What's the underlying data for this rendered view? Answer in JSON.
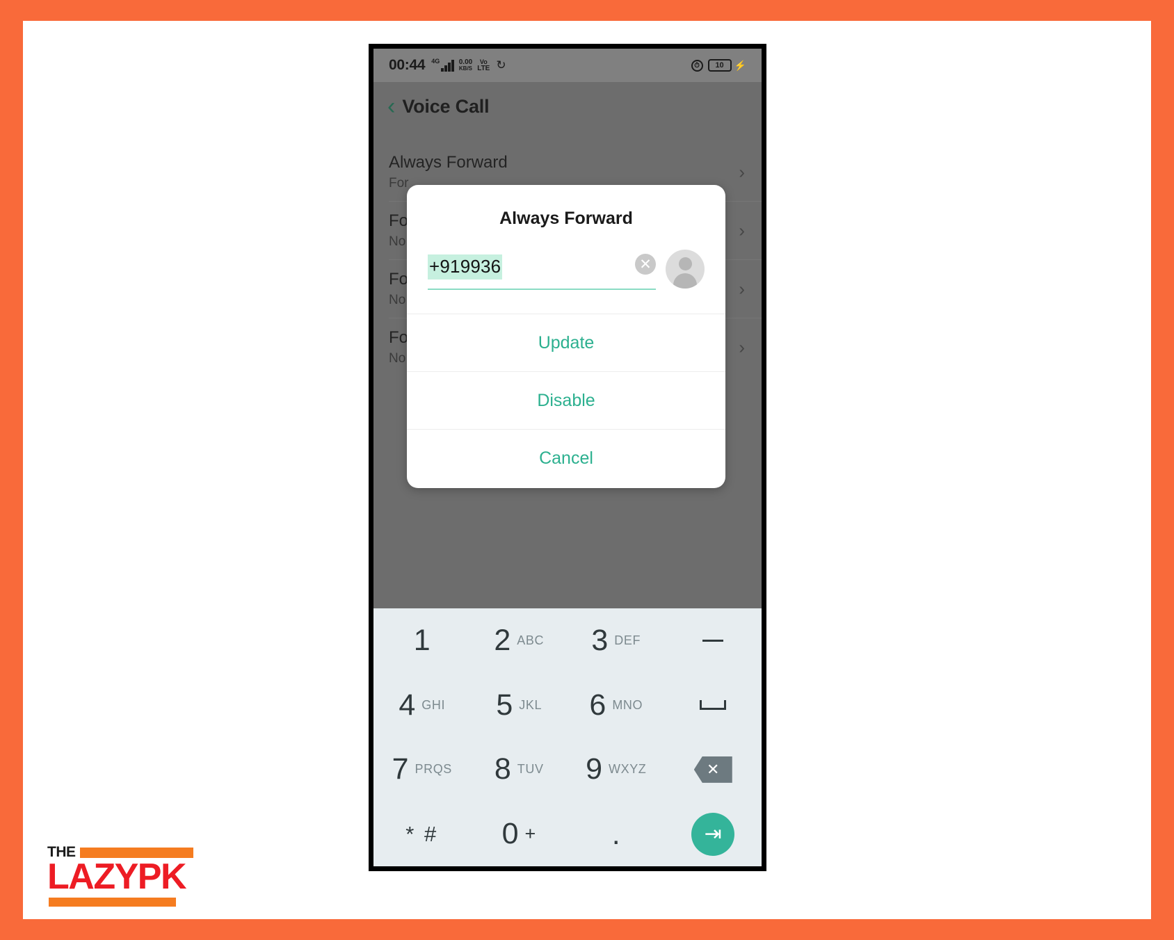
{
  "watermark": {
    "the": "THE",
    "name": "LAZYPK"
  },
  "colors": {
    "page_border": "#F96A3A",
    "accent_teal": "#2CB08F",
    "enter_key": "#34B49A",
    "arrow_red": "#C0191F",
    "selection_green": "#C6F0DF",
    "keypad_bg": "#E7EDF0",
    "logo_orange": "#F57C20",
    "logo_red": "#ED1C24"
  },
  "status_bar": {
    "time": "00:44",
    "network_gen": "4G",
    "data_rate_value": "0.00",
    "data_rate_unit": "KB/S",
    "volte_top": "Vo",
    "volte_bottom": "LTE",
    "sync_icon": "sync-icon",
    "alarm_icon": "alarm-icon",
    "battery_level": "10",
    "charging_icon": "charging-bolt-icon"
  },
  "app_bar": {
    "back_icon": "back-chevron-icon",
    "title": "Voice Call"
  },
  "settings_list": [
    {
      "title": "Always Forward",
      "subtitle": "For",
      "chevron": "chevron-right-icon"
    },
    {
      "title": "Fo",
      "subtitle": "No",
      "chevron": "chevron-right-icon"
    },
    {
      "title": "Fo",
      "subtitle": "No",
      "chevron": "chevron-right-icon"
    },
    {
      "title": "Fo",
      "subtitle": "No",
      "chevron": "chevron-right-icon"
    }
  ],
  "dialog": {
    "title": "Always Forward",
    "phone_number": "+919936",
    "clear_icon": "clear-circle-icon",
    "contact_icon": "contact-avatar-icon",
    "buttons": [
      {
        "label": "Update",
        "name": "update-button"
      },
      {
        "label": "Disable",
        "name": "disable-button"
      },
      {
        "label": "Cancel",
        "name": "cancel-button"
      }
    ]
  },
  "keypad": {
    "rows": [
      [
        {
          "num": "1",
          "sub": "",
          "type": "digit",
          "name": "key-1"
        },
        {
          "num": "2",
          "sub": "ABC",
          "type": "digit",
          "name": "key-2"
        },
        {
          "num": "3",
          "sub": "DEF",
          "type": "digit",
          "name": "key-3"
        },
        {
          "num": "",
          "sub": "",
          "type": "dash",
          "name": "key-dash"
        }
      ],
      [
        {
          "num": "4",
          "sub": "GHI",
          "type": "digit",
          "name": "key-4"
        },
        {
          "num": "5",
          "sub": "JKL",
          "type": "digit",
          "name": "key-5"
        },
        {
          "num": "6",
          "sub": "MNO",
          "type": "digit",
          "name": "key-6"
        },
        {
          "num": "",
          "sub": "",
          "type": "space",
          "name": "key-space"
        }
      ],
      [
        {
          "num": "7",
          "sub": "PRQS",
          "type": "digit",
          "name": "key-7"
        },
        {
          "num": "8",
          "sub": "TUV",
          "type": "digit",
          "name": "key-8"
        },
        {
          "num": "9",
          "sub": "WXYZ",
          "type": "digit",
          "name": "key-9"
        },
        {
          "num": "",
          "sub": "",
          "type": "back",
          "name": "key-backspace"
        }
      ],
      [
        {
          "num": "* #",
          "sub": "",
          "type": "star",
          "name": "key-star-hash"
        },
        {
          "num": "0",
          "sub": "+",
          "type": "digit",
          "name": "key-0"
        },
        {
          "num": ".",
          "sub": "",
          "type": "dot",
          "name": "key-dot"
        },
        {
          "num": "",
          "sub": "",
          "type": "enter",
          "name": "key-enter"
        }
      ]
    ]
  },
  "annotation": {
    "arrow": "red-arrow-pointing-to-disable"
  }
}
